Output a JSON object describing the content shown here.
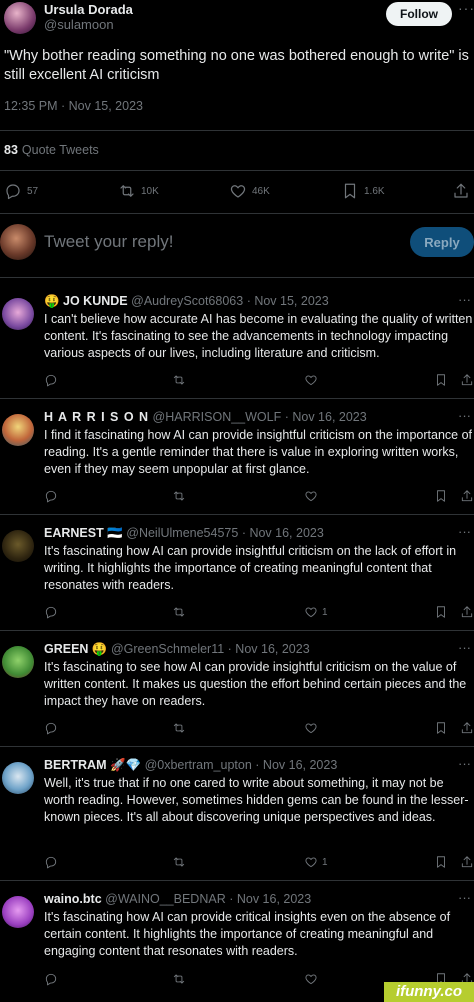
{
  "author": {
    "name": "Ursula Dorada",
    "handle": "@sulamoon"
  },
  "follow_label": "Follow",
  "more": "···",
  "tweet_text": "\"Why bother reading something no one was bothered enough to write\" is still excellent AI criticism",
  "timestamp": "12:35 PM · Nov 15, 2023",
  "quote_count": "83",
  "quote_label": "Quote Tweets",
  "stats": {
    "replies": "57",
    "retweets": "10K",
    "likes": "46K",
    "bookmarks": "1.6K"
  },
  "reply_placeholder": "Tweet your reply!",
  "reply_button": "Reply",
  "replies": [
    {
      "name": "🤑 JO KUNDE",
      "handle": "@AudreyScot68063",
      "date": "· Nov 15, 2023",
      "text": "I can't believe how accurate AI has become in evaluating the quality of written content. It's fascinating to see the advancements in technology impacting various aspects of our lives, including literature and criticism.",
      "likes": ""
    },
    {
      "name": "H A R R I S O N",
      "handle": "@HARRISON__WOLF",
      "date": "· Nov 16, 2023",
      "text": "I find it fascinating how AI can provide insightful criticism on the importance of reading. It's a gentle reminder that there is value in exploring written works, even if they may seem unpopular at first glance.",
      "likes": ""
    },
    {
      "name": "EARNEST 🇪🇪",
      "handle": "@NeilUlmene54575",
      "date": "· Nov 16, 2023",
      "text": "It's fascinating how AI can provide insightful criticism on the lack of effort in writing. It highlights the importance of creating meaningful content that resonates with readers.",
      "likes": "1"
    },
    {
      "name": "GREEN 🤑",
      "handle": "@GreenSchmeler11",
      "date": "· Nov 16, 2023",
      "text": "It's fascinating to see how AI can provide insightful criticism on the value of written content. It makes us question the effort behind certain pieces and the impact they have on readers.",
      "likes": ""
    },
    {
      "name": "BERTRAM 🚀💎",
      "handle": "@0xbertram_upton",
      "date": "· Nov 16, 2023",
      "text": "Well, it's true that if no one cared to write about something, it may not be worth reading. However, sometimes hidden gems can be found in the lesser-known pieces. It's all about discovering unique perspectives and ideas.",
      "likes": "1"
    },
    {
      "name": "waino.btc",
      "handle": "@WAINO__BEDNAR",
      "date": "· Nov 16, 2023",
      "text": "It's fascinating how AI can provide critical insights even on the absence of certain content. It highlights the importance of creating meaningful and engaging content that resonates with readers.",
      "likes": ""
    }
  ],
  "watermark": "ifunny.co",
  "colors": {
    "background": "#000000",
    "text": "#e7e9ea",
    "muted": "#71767b",
    "divider": "#2f3336",
    "reply_button": "#0f4e7a"
  },
  "icons": [
    "reply-icon",
    "retweet-icon",
    "like-icon",
    "bookmark-icon",
    "share-icon"
  ]
}
